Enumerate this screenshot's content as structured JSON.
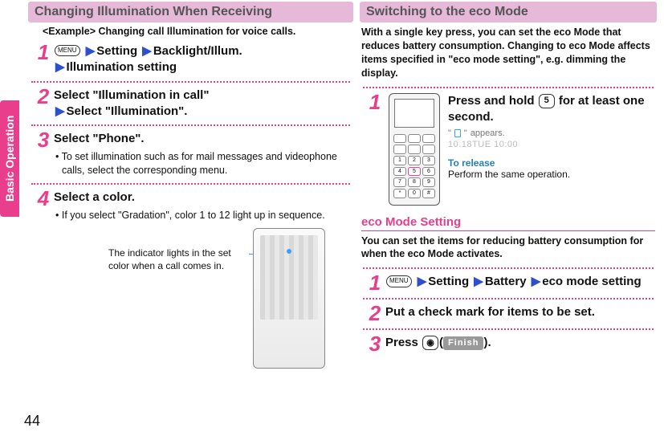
{
  "sideTab": "Basic Operation",
  "pageNumber": "44",
  "left": {
    "header": "Changing Illumination When Receiving",
    "example": "<Example> Changing call Illumination for voice calls.",
    "steps": [
      {
        "num": "1",
        "menuLabel": "MENU",
        "parts": [
          "Setting",
          "Backlight/Illum.",
          "Illumination setting"
        ]
      },
      {
        "num": "2",
        "line1": "Select \"Illumination in call\"",
        "line2": "Select \"Illumination\"."
      },
      {
        "num": "3",
        "title": "Select \"Phone\".",
        "bullet": "To set illumination such as for mail messages and videophone calls, select the corresponding menu."
      },
      {
        "num": "4",
        "title": "Select a color.",
        "bullet": "If you select \"Gradation\", color 1 to 12 light up in sequence."
      }
    ],
    "phoneCaption": "The indicator lights in the set color when a call comes in."
  },
  "right": {
    "header": "Switching to the eco Mode",
    "intro": "With a single key press, you can set the eco Mode that reduces battery consumption. Changing to eco Mode affects items specified in \"eco mode setting\", e.g. dimming the display.",
    "step1": {
      "num": "1",
      "titleA": "Press and hold ",
      "key": "5",
      "titleB": " for at least one second.",
      "appears": "appears.",
      "timeMock": "10.18TUE    10:00",
      "releaseLabel": "To release",
      "releaseText": "Perform the same operation."
    },
    "sub": {
      "heading": "eco Mode Setting",
      "intro": "You can set the items for reducing battery consumption for when the eco Mode activates.",
      "steps": [
        {
          "num": "1",
          "menuLabel": "MENU",
          "parts": [
            "Setting",
            "Battery",
            "eco mode setting"
          ]
        },
        {
          "num": "2",
          "title": "Put a check mark for items to be set."
        },
        {
          "num": "3",
          "titleA": "Press ",
          "camKey": "◉",
          "finish": "Finish",
          "titleB": "."
        }
      ]
    }
  }
}
